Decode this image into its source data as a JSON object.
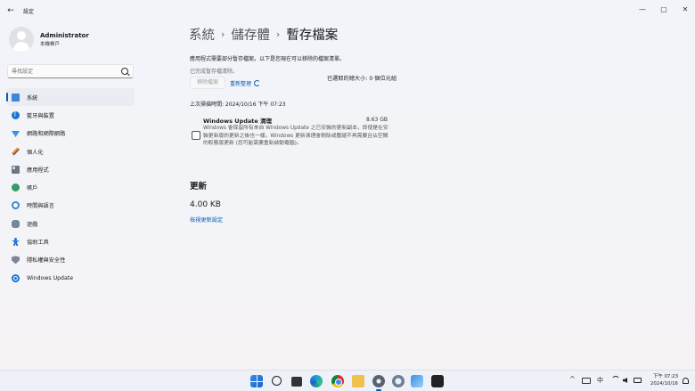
{
  "window": {
    "title": "設定",
    "back": "←",
    "minimize": "—",
    "maximize": "▢",
    "close": "✕"
  },
  "profile": {
    "name": "Administrator",
    "type": "本機帳戶"
  },
  "search": {
    "placeholder": "尋找設定"
  },
  "sidebar": {
    "items": [
      {
        "label": "系統",
        "icon": "system-icon",
        "selected": true
      },
      {
        "label": "藍牙與裝置",
        "icon": "bluetooth-icon"
      },
      {
        "label": "網路和網際網路",
        "icon": "network-icon"
      },
      {
        "label": "個人化",
        "icon": "personalization-icon"
      },
      {
        "label": "應用程式",
        "icon": "apps-icon"
      },
      {
        "label": "帳戶",
        "icon": "accounts-icon"
      },
      {
        "label": "時間與語言",
        "icon": "time-language-icon"
      },
      {
        "label": "遊戲",
        "icon": "gaming-icon"
      },
      {
        "label": "協助工具",
        "icon": "accessibility-icon"
      },
      {
        "label": "隱私權與安全性",
        "icon": "privacy-icon"
      },
      {
        "label": "Windows Update",
        "icon": "windows-update-icon"
      }
    ]
  },
  "breadcrumb": {
    "level1": "系統",
    "level2": "儲存體",
    "current": "暫存檔案",
    "separator": "›"
  },
  "main": {
    "description": "應用程式需要部分暫存檔案。以下是您現在可以移除的檔案清單。",
    "cleared_text": "已完成暫存檔清除。",
    "remove_button": "移除檔案",
    "rescan_link": "重新整理",
    "total_selected": "已選取的總大小: 0 個位元組",
    "last_scan": "上次掃描時間: 2024/10/16 下午 07:23",
    "item": {
      "title": "Windows Update 清理",
      "size": "8.63 GB",
      "description": "Windows 會保留所有來自 Windows Update 之已安裝的更新副本，即使是在安裝更新版的更新之後也一樣。Windows 更新清理會刪除或壓縮不再需要且佔空間的較舊版更新 (您可能需要重新啟動電腦)。",
      "checked": false
    },
    "updates": {
      "heading": "更新",
      "size": "4.00 KB",
      "link": "檢視更新設定"
    }
  },
  "taskbar": {
    "apps": [
      "start-icon",
      "search-icon",
      "task-view-icon",
      "edge-icon",
      "chrome-icon",
      "file-explorer-icon",
      "settings-icon",
      "snipping-icon",
      "photos-icon",
      "terminal-icon"
    ],
    "tray": {
      "chevron": "^",
      "ime": "中",
      "time": "下午 07:23",
      "date": "2024/10/16"
    }
  },
  "colors": {
    "accent": "#005fb8",
    "link": "#0a5bb5"
  }
}
